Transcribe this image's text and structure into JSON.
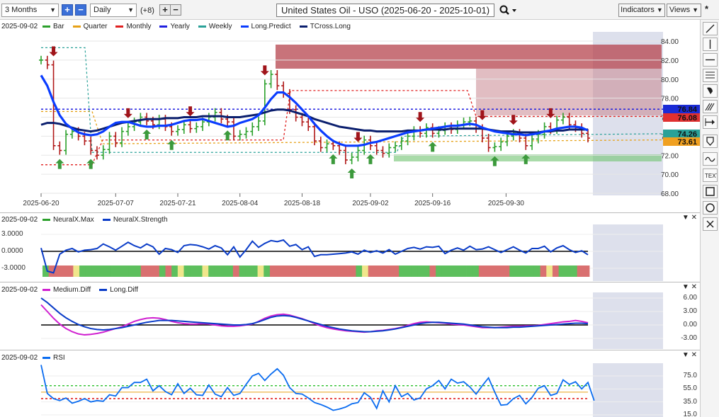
{
  "toolbar": {
    "period": "3 Months",
    "interval": "Daily",
    "overlays_count": "(+8)",
    "plus_label": "+",
    "minus_label": "−",
    "title": "United States Oil - USO (2025-06-20 - 2025-10-01)",
    "indicators_label": "Indicators",
    "views_label": "Views"
  },
  "main_panel": {
    "date": "2025-09-02",
    "legend": [
      {
        "label": "Bar",
        "color": "#2ca02c"
      },
      {
        "label": "Quarter",
        "color": "#e6a117"
      },
      {
        "label": "Monthly",
        "color": "#e02020"
      },
      {
        "label": "Yearly",
        "color": "#2020e0"
      },
      {
        "label": "Weekly",
        "color": "#2aa198"
      },
      {
        "label": "Long.Predict",
        "color": "#0a3cff"
      },
      {
        "label": "TCross.Long",
        "color": "#0b1f6e"
      }
    ],
    "price_axis": [
      "84.00",
      "82.00",
      "80.00",
      "78.00",
      "76.00",
      "74.00",
      "72.00",
      "70.00",
      "68.00"
    ],
    "date_axis": [
      "2025-06-20",
      "2025-07-07",
      "2025-07-21",
      "2025-08-04",
      "2025-08-18",
      "2025-09-02",
      "2025-09-16",
      "2025-09-30"
    ],
    "badges": [
      {
        "label": "76.84",
        "color": "#1a2bd6"
      },
      {
        "label": "76.08",
        "color": "#e03030"
      },
      {
        "label": "74.26",
        "color": "#2aa198"
      },
      {
        "label": "73.61",
        "color": "#f0a020"
      }
    ]
  },
  "neural_panel": {
    "date": "2025-09-02",
    "legend": [
      {
        "label": "NeuralX.Max",
        "color": "#2ca02c"
      },
      {
        "label": "NeuralX.Strength",
        "color": "#0a3cc8"
      }
    ],
    "axis": [
      "3.0000",
      "0.0000",
      "-3.0000"
    ]
  },
  "diff_panel": {
    "date": "2025-09-02",
    "legend": [
      {
        "label": "Medium.Diff",
        "color": "#d020d0"
      },
      {
        "label": "Long.Diff",
        "color": "#0a3cc8"
      }
    ],
    "axis": [
      "6.00",
      "3.00",
      "0.00",
      "-3.00"
    ]
  },
  "rsi_panel": {
    "date": "2025-09-02",
    "legend": [
      {
        "label": "RSI",
        "color": "#0a6cf0"
      }
    ],
    "axis": [
      "75.0",
      "55.0",
      "35.0",
      "15.0"
    ]
  },
  "chart_data": [
    {
      "type": "line",
      "name": "main",
      "title": "United States Oil - USO (2025-06-20 - 2025-10-01)",
      "ylim": [
        68,
        84
      ],
      "close": [
        82.0,
        81.5,
        73.0,
        72.5,
        74.2,
        74.5,
        74.0,
        73.5,
        72.5,
        72.0,
        72.6,
        74.0,
        73.3,
        74.5,
        75.0,
        75.5,
        76.0,
        75.6,
        75.2,
        75.8,
        75.0,
        74.5,
        74.7,
        75.2,
        74.8,
        75.0,
        75.5,
        76.0,
        76.5,
        75.8,
        75.5,
        74.0,
        74.2,
        74.5,
        75.0,
        75.6,
        79.5,
        80.5,
        79.3,
        78.5,
        76.8,
        76.0,
        75.5,
        75.0,
        73.5,
        72.8,
        73.2,
        73.0,
        72.5,
        71.5,
        71.8,
        72.5,
        73.6,
        73.0,
        72.5,
        72.2,
        72.8,
        73.0,
        73.5,
        74.0,
        74.6,
        74.3,
        74.9,
        74.3,
        74.6,
        75.0,
        74.7,
        75.2,
        75.5,
        75.6,
        74.8,
        73.8,
        72.8,
        72.9,
        73.4,
        74.0,
        74.3,
        73.8,
        73.0,
        73.7,
        74.2,
        75.0,
        74.7,
        75.7,
        76.0,
        75.2,
        74.9,
        74.3,
        73.8
      ],
      "long_predict": [
        80.4,
        79.3,
        77.6,
        76.2,
        75.3,
        74.8,
        74.4,
        74.2,
        74.1,
        74.2,
        74.5,
        75.0,
        75.4,
        75.5,
        75.5,
        75.3,
        75.1,
        75.0,
        75.0,
        75.1,
        75.1,
        75.2,
        75.4,
        75.6,
        75.7,
        75.7,
        75.8,
        75.6,
        75.4,
        75.2,
        75.0,
        75.1,
        75.4,
        75.6,
        75.8,
        76.2,
        77.0,
        77.9,
        78.6,
        78.6,
        78.1,
        77.5,
        76.8,
        76.1,
        75.3,
        74.6,
        74.0,
        73.5,
        73.2,
        73.0,
        73.0,
        73.0,
        73.1,
        73.3,
        73.4,
        73.6,
        73.8,
        74.0,
        74.2,
        74.4,
        74.5,
        74.6,
        74.7,
        74.8,
        74.9,
        75.0,
        75.1,
        75.1,
        75.2,
        75.3,
        75.2,
        74.9,
        74.7,
        74.5,
        74.4,
        74.3,
        74.2,
        74.2,
        74.1,
        74.2,
        74.3,
        74.5,
        74.6,
        74.8,
        74.9,
        75.0,
        75.0,
        74.9,
        74.6
      ],
      "tcross_long": [
        75.2,
        75.4,
        75.4,
        75.3,
        75.1,
        74.9,
        74.7,
        74.6,
        74.5,
        74.6,
        74.8,
        75.0,
        75.2,
        75.4,
        75.5,
        75.6,
        75.7,
        75.8,
        75.8,
        75.8,
        75.9,
        75.9,
        75.9,
        76.0,
        76.0,
        76.0,
        76.1,
        76.1,
        76.1,
        76.1,
        76.0,
        76.0,
        76.0,
        76.1,
        76.2,
        76.3,
        76.5,
        76.7,
        76.8,
        76.8,
        76.7,
        76.5,
        76.3,
        76.1,
        75.8,
        75.6,
        75.4,
        75.2,
        75.0,
        74.9,
        74.8,
        74.7,
        74.6,
        74.6,
        74.5,
        74.5,
        74.5,
        74.5,
        74.5,
        74.6,
        74.6,
        74.6,
        74.7,
        74.7,
        74.7,
        74.7,
        74.8,
        74.8,
        74.8,
        74.8,
        74.8,
        74.8,
        74.7,
        74.6,
        74.5,
        74.5,
        74.5,
        74.4,
        74.4,
        74.4,
        74.4,
        74.5,
        74.5,
        74.6,
        74.6,
        74.7,
        74.7,
        74.7,
        74.7
      ],
      "yearly": 76.84,
      "monthly": 76.08,
      "weekly": 74.26,
      "quarter": 73.61
    },
    {
      "type": "line",
      "name": "neuralx_strength",
      "ylim": [
        -4.5,
        4.5
      ],
      "values": [
        0.6,
        -3.5,
        -3.8,
        -0.5,
        0.2,
        0.5,
        -0.1,
        0.2,
        0.3,
        0.5,
        1.3,
        0.8,
        0.2,
        0.9,
        1.6,
        1.0,
        0.6,
        1.3,
        0.8,
        -0.5,
        0.5,
        0.3,
        -0.2,
        1.0,
        1.2,
        1.1,
        0.8,
        0.4,
        1.0,
        0.6,
        -0.6,
        0.8,
        -1.0,
        0.3,
        1.8,
        0.7,
        1.4,
        1.9,
        1.7,
        2.0,
        0.9,
        1.2,
        0.3,
        0.8,
        -0.9,
        -0.6,
        -0.6,
        -0.5,
        -0.4,
        -0.3,
        -0.1,
        -0.5,
        0.2,
        -0.2,
        0.1,
        -0.3,
        0.3,
        -0.5,
        0.0,
        0.5,
        0.7,
        0.4,
        0.8,
        0.7,
        0.9,
        -0.4,
        0.2,
        0.6,
        0.2,
        0.9,
        0.3,
        0.4,
        0.8,
        0.3,
        -0.2,
        0.3,
        0.8,
        0.2,
        -0.3,
        0.5,
        0.5,
        0.9,
        -0.1,
        0.6,
        1.0,
        0.3,
        -0.2,
        0.1,
        -0.6
      ]
    },
    {
      "type": "line",
      "name": "diff",
      "ylim": [
        -5,
        7
      ],
      "medium_diff": [
        4.5,
        3.0,
        1.5,
        0.2,
        -0.8,
        -1.5,
        -2.0,
        -2.2,
        -2.1,
        -1.9,
        -1.6,
        -1.2,
        -0.8,
        -0.4,
        0.2,
        0.8,
        1.2,
        1.5,
        1.6,
        1.5,
        1.2,
        0.8,
        0.5,
        0.3,
        0.2,
        0.2,
        0.3,
        0.2,
        0.0,
        -0.2,
        -0.3,
        -0.3,
        -0.2,
        0.0,
        0.2,
        0.8,
        1.5,
        2.0,
        2.3,
        2.4,
        2.2,
        1.8,
        1.4,
        0.9,
        0.3,
        -0.2,
        -0.6,
        -0.9,
        -1.1,
        -1.3,
        -1.4,
        -1.5,
        -1.6,
        -1.5,
        -1.3,
        -1.2,
        -1.0,
        -0.8,
        -0.5,
        -0.1,
        0.3,
        0.6,
        0.7,
        0.6,
        0.5,
        0.4,
        0.2,
        0.1,
        0.0,
        -0.2,
        -0.4,
        -0.6,
        -0.6,
        -0.6,
        -0.5,
        -0.4,
        -0.3,
        -0.3,
        -0.2,
        -0.2,
        -0.1,
        0.1,
        0.3,
        0.5,
        0.7,
        0.8,
        1.0,
        0.8,
        0.5
      ],
      "long_diff": [
        6.0,
        5.0,
        3.8,
        2.6,
        1.6,
        0.8,
        0.1,
        -0.4,
        -0.8,
        -1.0,
        -1.1,
        -1.0,
        -0.8,
        -0.6,
        -0.3,
        0.0,
        0.3,
        0.6,
        0.8,
        1.0,
        1.0,
        1.0,
        0.9,
        0.8,
        0.7,
        0.6,
        0.5,
        0.4,
        0.3,
        0.2,
        0.1,
        0.0,
        0.0,
        0.1,
        0.3,
        0.7,
        1.2,
        1.7,
        2.0,
        2.1,
        2.0,
        1.7,
        1.3,
        0.9,
        0.5,
        0.1,
        -0.3,
        -0.6,
        -0.9,
        -1.1,
        -1.3,
        -1.4,
        -1.5,
        -1.5,
        -1.4,
        -1.3,
        -1.1,
        -0.9,
        -0.6,
        -0.3,
        0.0,
        0.3,
        0.5,
        0.6,
        0.6,
        0.5,
        0.4,
        0.3,
        0.2,
        0.0,
        -0.2,
        -0.4,
        -0.5,
        -0.6,
        -0.6,
        -0.6,
        -0.5,
        -0.5,
        -0.4,
        -0.3,
        -0.2,
        -0.1,
        0.0,
        0.1,
        0.2,
        0.3,
        0.4,
        0.4,
        0.3
      ]
    },
    {
      "type": "line",
      "name": "rsi",
      "ylim": [
        15,
        95
      ],
      "levels": [
        60,
        50,
        40
      ],
      "values": [
        92,
        48,
        40,
        37,
        41,
        33,
        36,
        40,
        35,
        37,
        36,
        46,
        44,
        57,
        57,
        65,
        65,
        70,
        52,
        60,
        51,
        46,
        63,
        48,
        56,
        46,
        45,
        61,
        47,
        43,
        57,
        45,
        48,
        62,
        75,
        79,
        68,
        78,
        86,
        76,
        57,
        48,
        47,
        41,
        34,
        31,
        27,
        22,
        24,
        27,
        32,
        34,
        49,
        42,
        25,
        52,
        35,
        60,
        43,
        48,
        38,
        41,
        55,
        60,
        68,
        55,
        70,
        64,
        66,
        58,
        47,
        60,
        72,
        50,
        30,
        31,
        40,
        45,
        32,
        42,
        56,
        60,
        45,
        48,
        69,
        62,
        66,
        55,
        65,
        37
      ]
    }
  ]
}
